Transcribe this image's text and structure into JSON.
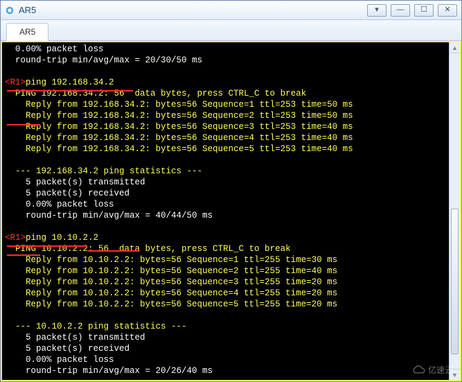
{
  "window": {
    "title": "AR5",
    "buttons": {
      "more": "▾",
      "min": "—",
      "max": "☐",
      "close": "✕"
    }
  },
  "tabs": [
    {
      "label": "AR5"
    }
  ],
  "scroll": {
    "up": "▲",
    "down": "▼"
  },
  "watermark": {
    "text": "亿速云"
  },
  "terminal": {
    "lines": [
      {
        "cls": "",
        "indent": 2,
        "text": "0.00% packet loss"
      },
      {
        "cls": "",
        "indent": 2,
        "text": "round-trip min/avg/max = 20/30/50 ms"
      },
      {
        "cls": "",
        "indent": 0,
        "text": ""
      },
      {
        "cls": "prompt1",
        "indent": 0,
        "text": ""
      },
      {
        "cls": "yellow",
        "indent": 2,
        "text": "PING 192.168.34.2: 56  data bytes, press CTRL_C to break"
      },
      {
        "cls": "yellow",
        "indent": 4,
        "text": "Reply from 192.168.34.2: bytes=56 Sequence=1 ttl=253 time=50 ms"
      },
      {
        "cls": "yellow",
        "indent": 4,
        "text": "Reply from 192.168.34.2: bytes=56 Sequence=2 ttl=253 time=50 ms"
      },
      {
        "cls": "yellow",
        "indent": 4,
        "text": "Reply from 192.168.34.2: bytes=56 Sequence=3 ttl=253 time=40 ms"
      },
      {
        "cls": "yellow",
        "indent": 4,
        "text": "Reply from 192.168.34.2: bytes=56 Sequence=4 ttl=253 time=40 ms"
      },
      {
        "cls": "yellow",
        "indent": 4,
        "text": "Reply from 192.168.34.2: bytes=56 Sequence=5 ttl=253 time=40 ms"
      },
      {
        "cls": "",
        "indent": 0,
        "text": ""
      },
      {
        "cls": "yellow",
        "indent": 2,
        "text": "--- 192.168.34.2 ping statistics ---"
      },
      {
        "cls": "",
        "indent": 4,
        "text": "5 packet(s) transmitted"
      },
      {
        "cls": "",
        "indent": 4,
        "text": "5 packet(s) received"
      },
      {
        "cls": "",
        "indent": 4,
        "text": "0.00% packet loss"
      },
      {
        "cls": "",
        "indent": 4,
        "text": "round-trip min/avg/max = 40/44/50 ms"
      },
      {
        "cls": "",
        "indent": 0,
        "text": ""
      },
      {
        "cls": "prompt2",
        "indent": 0,
        "text": ""
      },
      {
        "cls": "yellow",
        "indent": 2,
        "text": "PING 10.10.2.2: 56  data bytes, press CTRL_C to break"
      },
      {
        "cls": "yellow",
        "indent": 4,
        "text": "Reply from 10.10.2.2: bytes=56 Sequence=1 ttl=255 time=30 ms"
      },
      {
        "cls": "yellow",
        "indent": 4,
        "text": "Reply from 10.10.2.2: bytes=56 Sequence=2 ttl=255 time=40 ms"
      },
      {
        "cls": "yellow",
        "indent": 4,
        "text": "Reply from 10.10.2.2: bytes=56 Sequence=3 ttl=255 time=20 ms"
      },
      {
        "cls": "yellow",
        "indent": 4,
        "text": "Reply from 10.10.2.2: bytes=56 Sequence=4 ttl=255 time=20 ms"
      },
      {
        "cls": "yellow",
        "indent": 4,
        "text": "Reply from 10.10.2.2: bytes=56 Sequence=5 ttl=255 time=20 ms"
      },
      {
        "cls": "",
        "indent": 0,
        "text": ""
      },
      {
        "cls": "yellow",
        "indent": 2,
        "text": "--- 10.10.2.2 ping statistics ---"
      },
      {
        "cls": "",
        "indent": 4,
        "text": "5 packet(s) transmitted"
      },
      {
        "cls": "",
        "indent": 4,
        "text": "5 packet(s) received"
      },
      {
        "cls": "",
        "indent": 4,
        "text": "0.00% packet loss"
      },
      {
        "cls": "",
        "indent": 4,
        "text": "round-trip min/avg/max = 20/26/40 ms"
      }
    ],
    "prompt1": {
      "prefix": "<R1>",
      "cmd": "ping 192.168.34.2"
    },
    "prompt2": {
      "prefix": "<R1>",
      "cmd": "ping 10.10.2.2"
    }
  }
}
